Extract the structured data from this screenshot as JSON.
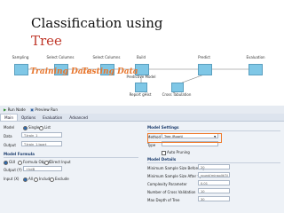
{
  "slide": {
    "title_line1": "Classification using",
    "title_line2": "Tree"
  },
  "workflow": {
    "nodes": [
      {
        "label": "Sampling"
      },
      {
        "label": "Select Columns"
      },
      {
        "label": "Select Columns"
      },
      {
        "label": "Build",
        "sublabel": "Predictive Model"
      },
      {
        "label": "Predict"
      },
      {
        "label": "Evaluation"
      }
    ],
    "lower_nodes": [
      "Report gHist",
      "Cross Tabulation"
    ],
    "annotations": {
      "training": "Training Data",
      "testing": "Testing Data"
    }
  },
  "ui": {
    "toolbar": {
      "run_node": "Run Node",
      "preview_run": "Preview Run"
    },
    "tabs": [
      "Main",
      "Options",
      "Evaluation",
      "Advanced"
    ],
    "active_tab": "Main",
    "model": {
      "label": "Model",
      "single": "Single",
      "list": "List"
    },
    "data": {
      "label": "Data",
      "value": "T.train_1"
    },
    "output": {
      "label": "Output",
      "value": "T.train_1.tpart"
    },
    "model_formula": {
      "header": "Model Formula",
      "options": [
        "GUI",
        "Formula Object",
        "Direct Input"
      ],
      "output_y_label": "Output (Y)",
      "output_y_value": "+hdB",
      "input_x_label": "Input (X)",
      "input_x_options": [
        "All",
        "Include",
        "Exclude"
      ]
    },
    "model_settings": {
      "header": "Model Settings",
      "method_label": "Method",
      "method_value": "Tree (Rpart)",
      "type_label": "Type",
      "auto_pruning": "Auto Pruning"
    },
    "model_details": {
      "header": "Model Details",
      "rows": [
        {
          "label": "Minimum Sample Size Before Split",
          "value": "20"
        },
        {
          "label": "Minimum Sample Size After Split",
          "value": "round(minsplit/3)"
        },
        {
          "label": "Complexity Parameter",
          "value": "0.01"
        },
        {
          "label": "Number of Cross Validation",
          "value": "10"
        },
        {
          "label": "Max Depth of Tree",
          "value": "30"
        }
      ]
    }
  }
}
